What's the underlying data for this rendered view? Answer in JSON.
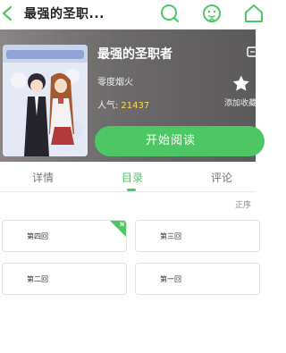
{
  "topbar": {
    "title": "最强的圣职...",
    "accent": "#4cc763",
    "icons": [
      "back-arrow-icon",
      "search-icon",
      "face-icon",
      "home-icon"
    ]
  },
  "book": {
    "title": "最强的圣职者",
    "author": "零度烟火",
    "popularity_label": "人气:",
    "popularity_value": "21437",
    "favorite_label": "添加收藏",
    "read_button": "开始阅读"
  },
  "tabs": [
    {
      "label": "详情",
      "active": false
    },
    {
      "label": "目录",
      "active": true
    },
    {
      "label": "评论",
      "active": false
    }
  ],
  "sort_label": "正序",
  "chapters": [
    {
      "label": "第四回",
      "is_new": true,
      "badge": "N"
    },
    {
      "label": "第三回",
      "is_new": false
    },
    {
      "label": "第二回",
      "is_new": false
    },
    {
      "label": "第一回",
      "is_new": false
    }
  ]
}
